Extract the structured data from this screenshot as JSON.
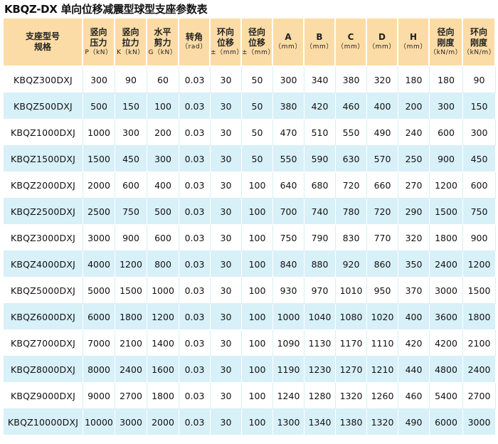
{
  "title": "KBQZ-DX 单向位移减震型球型支座参数表",
  "colors": {
    "header_bg": "#fcdca6",
    "row_alt_bg": "#d8f0f8",
    "row_bg": "#ffffff"
  },
  "headers": [
    {
      "l1": "支座型号",
      "l2": "规格",
      "sub": ""
    },
    {
      "l1": "竖向",
      "l2": "压力",
      "sub": "P（kN）"
    },
    {
      "l1": "竖向",
      "l2": "拉力",
      "sub": "K（kN）"
    },
    {
      "l1": "水平",
      "l2": "剪力",
      "sub": "G（kN）"
    },
    {
      "l1": "转角",
      "l2": "",
      "sub": "（rad）"
    },
    {
      "l1": "环向",
      "l2": "位移",
      "sub": "±（mm）"
    },
    {
      "l1": "径向",
      "l2": "位移",
      "sub": "±（mm）"
    },
    {
      "l1": "A",
      "l2": "",
      "sub": "（mm）"
    },
    {
      "l1": "B",
      "l2": "",
      "sub": "（mm）"
    },
    {
      "l1": "C",
      "l2": "",
      "sub": "（mm）"
    },
    {
      "l1": "D",
      "l2": "",
      "sub": "（mm）"
    },
    {
      "l1": "H",
      "l2": "",
      "sub": "（mm）"
    },
    {
      "l1": "径向",
      "l2": "刚度",
      "sub": "（kN/m）"
    },
    {
      "l1": "环向",
      "l2": "刚度",
      "sub": "（kN/m）"
    }
  ],
  "rows": [
    [
      "KBQZ300DXJ",
      "300",
      "90",
      "60",
      "0.03",
      "30",
      "50",
      "300",
      "340",
      "380",
      "320",
      "180",
      "180",
      "90"
    ],
    [
      "KBQZ500DXJ",
      "500",
      "150",
      "100",
      "0.03",
      "30",
      "50",
      "380",
      "420",
      "460",
      "400",
      "200",
      "300",
      "150"
    ],
    [
      "KBQZ1000DXJ",
      "1000",
      "300",
      "200",
      "0.03",
      "30",
      "50",
      "470",
      "510",
      "550",
      "490",
      "240",
      "600",
      "300"
    ],
    [
      "KBQZ1500DXJ",
      "1500",
      "450",
      "300",
      "0.03",
      "30",
      "50",
      "550",
      "590",
      "630",
      "570",
      "250",
      "900",
      "450"
    ],
    [
      "KBQZ2000DXJ",
      "2000",
      "600",
      "400",
      "0.03",
      "30",
      "100",
      "640",
      "680",
      "720",
      "660",
      "270",
      "1200",
      "600"
    ],
    [
      "KBQZ2500DXJ",
      "2500",
      "750",
      "500",
      "0.03",
      "30",
      "100",
      "700",
      "740",
      "780",
      "720",
      "290",
      "1500",
      "750"
    ],
    [
      "KBQZ3000DXJ",
      "3000",
      "900",
      "600",
      "0.03",
      "30",
      "100",
      "750",
      "790",
      "830",
      "770",
      "320",
      "1800",
      "900"
    ],
    [
      "KBQZ4000DXJ",
      "4000",
      "1200",
      "800",
      "0.03",
      "30",
      "100",
      "840",
      "880",
      "920",
      "860",
      "350",
      "2400",
      "1200"
    ],
    [
      "KBQZ5000DXJ",
      "5000",
      "1500",
      "1000",
      "0.03",
      "30",
      "100",
      "930",
      "970",
      "1010",
      "950",
      "370",
      "3000",
      "1500"
    ],
    [
      "KBQZ6000DXJ",
      "6000",
      "1800",
      "1200",
      "0.03",
      "30",
      "100",
      "1000",
      "1040",
      "1080",
      "1020",
      "400",
      "3600",
      "1800"
    ],
    [
      "KBQZ7000DXJ",
      "7000",
      "2100",
      "1400",
      "0.03",
      "30",
      "100",
      "1090",
      "1130",
      "1170",
      "1110",
      "420",
      "4200",
      "2100"
    ],
    [
      "KBQZ8000DXJ",
      "8000",
      "2400",
      "1600",
      "0.03",
      "30",
      "100",
      "1190",
      "1230",
      "1270",
      "1210",
      "440",
      "4800",
      "2400"
    ],
    [
      "KBQZ9000DXJ",
      "9000",
      "2700",
      "1800",
      "0.03",
      "30",
      "100",
      "1240",
      "1280",
      "1320",
      "1260",
      "460",
      "5400",
      "2700"
    ],
    [
      "KBQZ10000DXJ",
      "10000",
      "3000",
      "2000",
      "0.03",
      "30",
      "100",
      "1300",
      "1340",
      "1380",
      "1320",
      "490",
      "6000",
      "3000"
    ]
  ]
}
